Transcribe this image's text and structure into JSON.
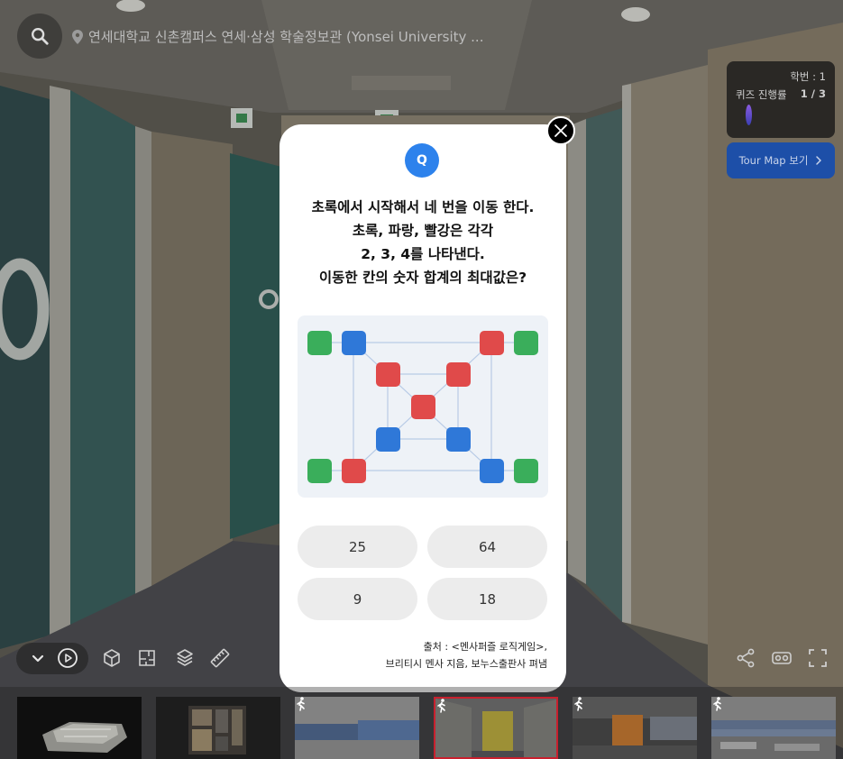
{
  "header": {
    "location_text": "연세대학교 신촌캠퍼스 연세·삼성 학술정보관 (Yonsei University ..."
  },
  "quiz_status": {
    "student_id": "학번 : 1",
    "progress_label": "퀴즈 진행률",
    "progress_value": "1 / 3"
  },
  "tour_map_button": {
    "label": "Tour Map 보기"
  },
  "quiz": {
    "badge": "Q",
    "question_lines": [
      "초록에서 시작해서 네 번을 이동 한다.",
      "초록, 파랑, 빨강은 각각",
      "2, 3, 4를 나타낸다.",
      "이동한 칸의 숫자 합계의 최대값은?"
    ],
    "puzzle": {
      "colors": {
        "green": "#3aae5b",
        "blue": "#2f78d8",
        "red": "#e04a4a"
      },
      "nodes": [
        "#3aae5b",
        "#2f78d8",
        "#e04a4a",
        "#3aae5b",
        "#e04a4a",
        "#e04a4a",
        "#e04a4a",
        "#2f78d8",
        "#2f78d8",
        "#3aae5b",
        "#e04a4a",
        "#2f78d8",
        "#3aae5b"
      ]
    },
    "answers": [
      "25",
      "64",
      "9",
      "18"
    ],
    "source_lines": [
      "출처 : <멘사퍼즐 로직게임>,",
      "브리티시 멘사 지음, 보누스출판사 펴냄"
    ]
  },
  "toolbar": {
    "left": [
      "chevron-down-icon",
      "play-icon"
    ],
    "tools": [
      "dollhouse-icon",
      "floorplan-icon",
      "layers-icon",
      "measure-icon"
    ],
    "right": [
      "share-icon",
      "vr-icon",
      "fullscreen-icon"
    ]
  },
  "thumbnail_strip": {
    "selected": 4
  },
  "colors": {
    "accent": "#2d82ec",
    "tour_map_button": "#1d4fa8",
    "selected_thumbnail_border": "#c8202e",
    "answer_button": "#ececec"
  }
}
